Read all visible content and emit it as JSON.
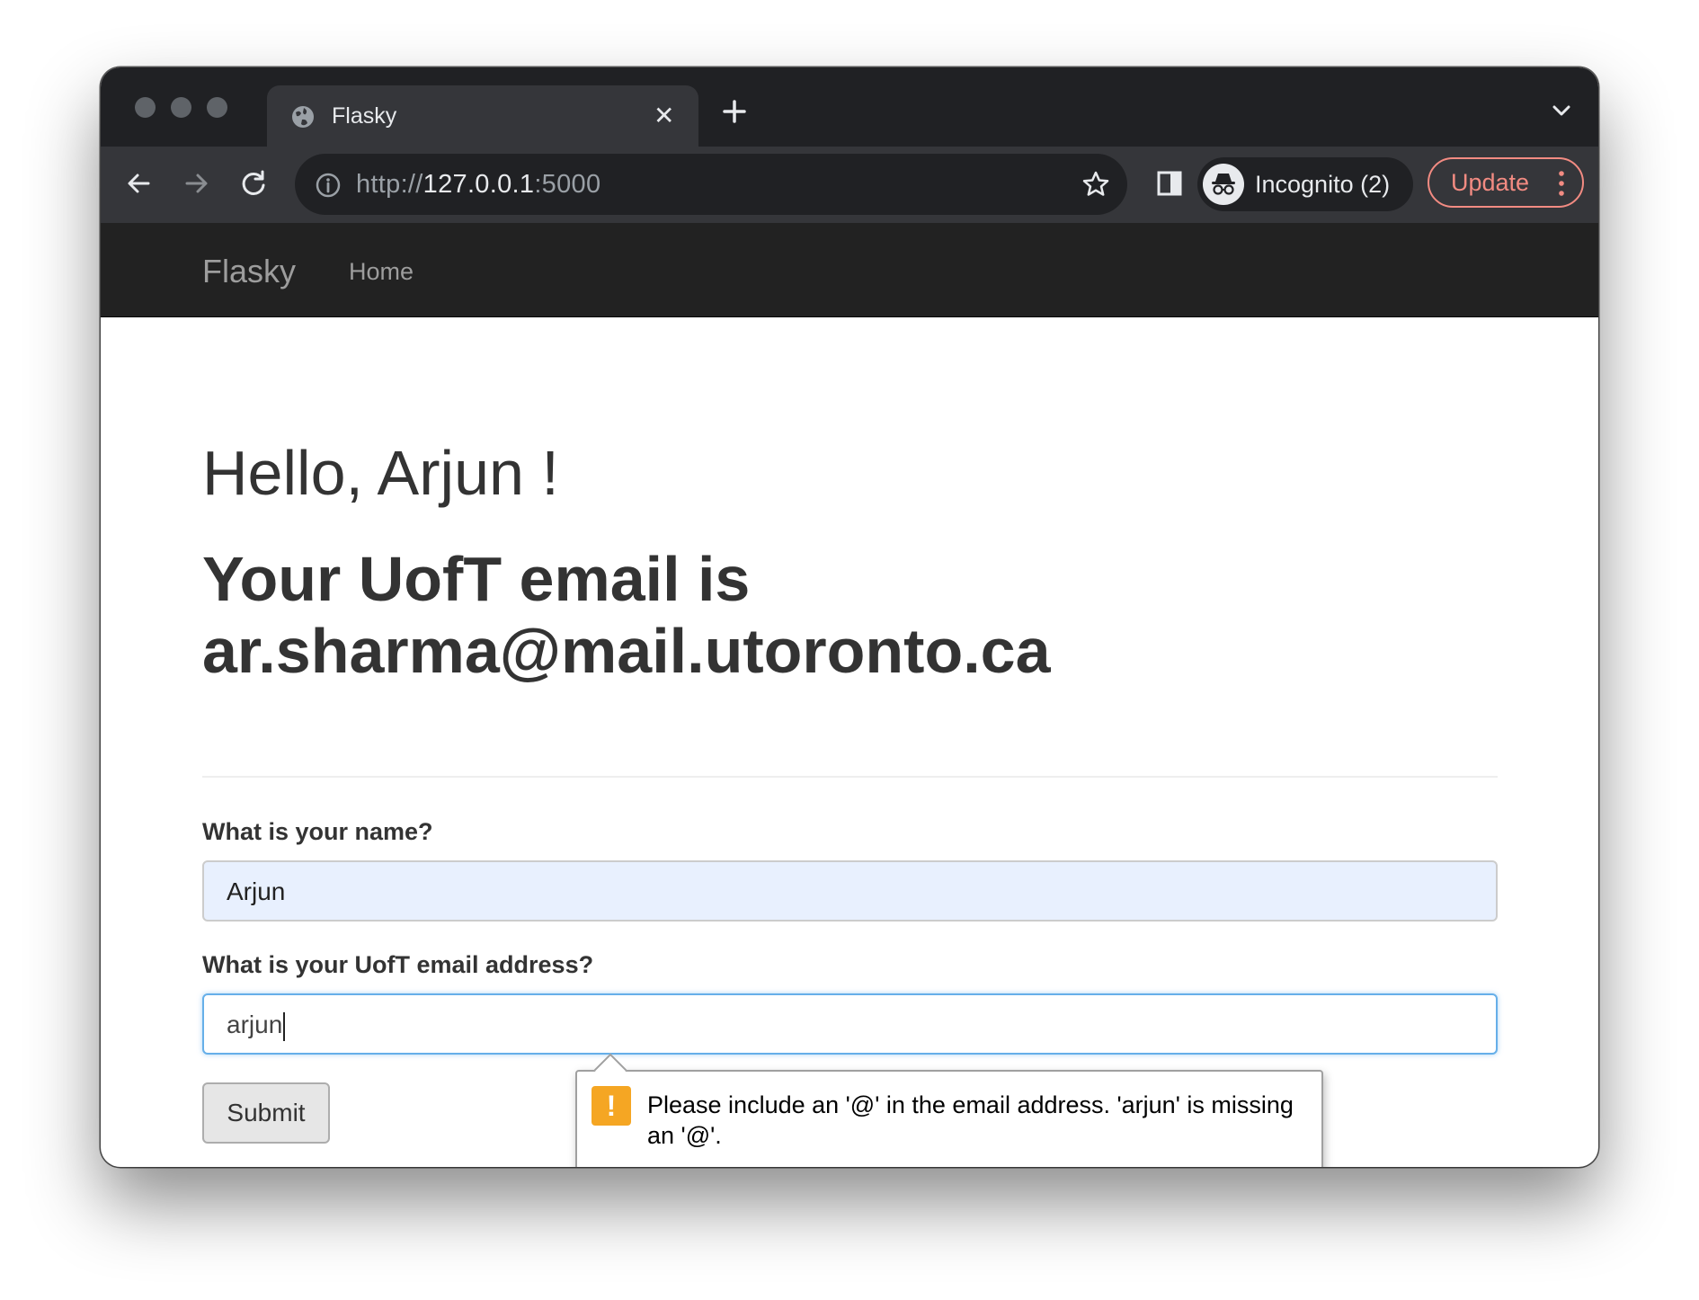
{
  "browser": {
    "tab_title": "Flasky",
    "url_scheme": "http://",
    "url_host": "127.0.0.1",
    "url_port": ":5000",
    "profile_label": "Incognito (2)",
    "update_label": "Update",
    "icons": [
      "globe-icon",
      "close-icon",
      "plus-icon",
      "chevron-down-icon",
      "back-arrow-icon",
      "forward-arrow-icon",
      "reload-icon",
      "info-icon",
      "star-icon",
      "side-panel-icon",
      "incognito-icon",
      "more-vert-icon"
    ],
    "accent_color": "#f28b82"
  },
  "navbar": {
    "brand": "Flasky",
    "links": [
      {
        "label": "Home"
      }
    ]
  },
  "main": {
    "greeting": "Hello, Arjun !",
    "email_line_1": "Your UofT email is",
    "email_line_2": "ar.sharma@mail.utoronto.ca"
  },
  "form": {
    "name_label": "What is your name?",
    "name_value": "Arjun",
    "email_label": "What is your UofT email address?",
    "email_value": "arjun",
    "submit_label": "Submit"
  },
  "validation": {
    "icon": "warning-icon",
    "message": "Please include an '@' in the email address. 'arjun' is missing an '@'.",
    "icon_color": "#f5a623"
  }
}
